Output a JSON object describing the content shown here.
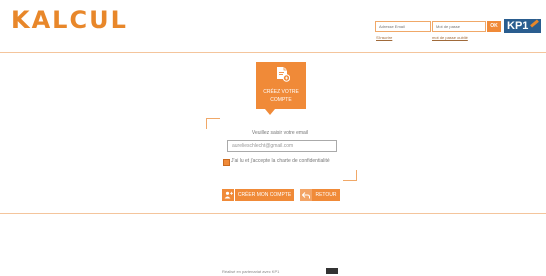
{
  "header": {
    "logo": "KALCUL",
    "email_placeholder": "Adresse Email",
    "password_placeholder": "Mot de passe",
    "ok_label": "OK",
    "badge_label": "KP1",
    "register_link": "S'inscrire",
    "forgot_link": "mot de passe oublié"
  },
  "signup": {
    "tile_title": "CRÉEZ VOTRE COMPTE",
    "prompt": "Veuillez saisir votre email",
    "email_value": "aurelieschlecht@gmail.com",
    "consent_checked": true,
    "consent_label": "J'ai lu et j'accepte la charte de confidentialité",
    "create_label": "CRÉER MON COMPTE",
    "back_label": "RETOUR"
  },
  "footer": {
    "text": "Réalisé en partenariat avec KP1"
  },
  "colors": {
    "accent": "#f08a38",
    "badge": "#2a5d8f"
  },
  "icons": [
    "document-plus-icon",
    "add-user-icon",
    "back-arrow-icon",
    "pen-icon"
  ]
}
